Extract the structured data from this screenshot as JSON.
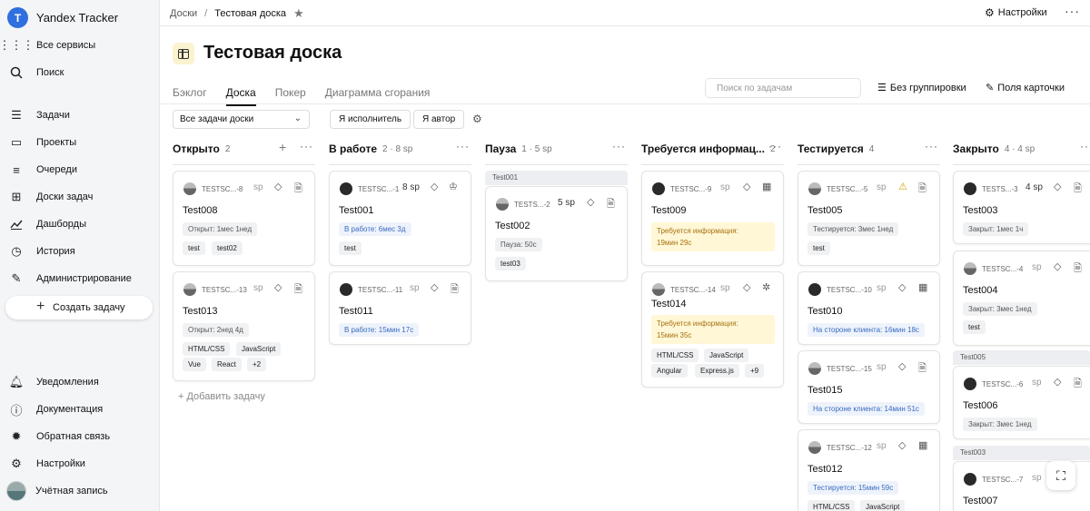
{
  "app": {
    "name": "Yandex Tracker",
    "logo_glyph": "T"
  },
  "sidebar": {
    "items": [
      {
        "label": "Все сервисы",
        "icon": "grid-icon"
      },
      {
        "label": "Поиск",
        "icon": "search-icon"
      },
      {
        "label": "Задачи",
        "icon": "tasks-icon"
      },
      {
        "label": "Проекты",
        "icon": "projects-icon"
      },
      {
        "label": "Очереди",
        "icon": "queues-icon"
      },
      {
        "label": "Доски задач",
        "icon": "boards-icon"
      },
      {
        "label": "Дашборды",
        "icon": "dashboards-icon"
      },
      {
        "label": "История",
        "icon": "history-icon"
      },
      {
        "label": "Администрирование",
        "icon": "admin-icon"
      }
    ],
    "create_label": "Создать задачу",
    "bottom_items": [
      {
        "label": "Уведомления",
        "icon": "bell-icon"
      },
      {
        "label": "Документация",
        "icon": "help-icon"
      },
      {
        "label": "Обратная связь",
        "icon": "feedback-icon"
      },
      {
        "label": "Настройки",
        "icon": "gear-icon"
      },
      {
        "label": "Учётная запись",
        "icon": "avatar"
      }
    ]
  },
  "header": {
    "breadcrumb": [
      "Доски",
      "Тестовая доска"
    ],
    "settings_label": "Настройки",
    "title": "Тестовая доска",
    "tabs": [
      "Бэклог",
      "Доска",
      "Покер",
      "Диаграмма сгорания"
    ],
    "active_tab": "Доска",
    "search_placeholder": "Поиск по задачам",
    "grouping_label": "Без группировки",
    "fields_label": "Поля карточки"
  },
  "filters": {
    "select_value": "Все задачи доски",
    "chips": [
      "Я исполнитель",
      "Я автор"
    ]
  },
  "columns": [
    {
      "title": "Открыто",
      "count": "2"
    },
    {
      "title": "В работе",
      "count": "2 · 8 sp"
    },
    {
      "title": "Пауза",
      "count": "1 · 5 sp"
    },
    {
      "title": "Требуется информац...",
      "count": "2"
    },
    {
      "title": "Тестируется",
      "count": "4"
    },
    {
      "title": "Закрыто",
      "count": "4 · 4 sp"
    }
  ],
  "cards": {
    "test008": {
      "key": "TESTSC...-8",
      "sp": "sp",
      "title": "Test008",
      "status": "Открыт: 1мес 1нед",
      "tags": [
        "test",
        "test02"
      ]
    },
    "test013": {
      "key": "TESTSC...-13",
      "sp": "sp",
      "title": "Test013",
      "status": "Открыт: 2нед 4д",
      "tags": [
        "HTML/CSS",
        "JavaScript",
        "Vue",
        "React",
        "+2"
      ]
    },
    "test001": {
      "key": "TESTSC...-1",
      "sp": "8 sp",
      "title": "Test001",
      "status": "В работе: 6мес 3д",
      "tags": [
        "test"
      ]
    },
    "test011": {
      "key": "TESTSC...-11",
      "sp": "sp",
      "title": "Test011",
      "status": "В работе: 15мин 17с"
    },
    "test002": {
      "group": "Test001",
      "key": "TESTS...-2",
      "sp": "5 sp",
      "title": "Test002",
      "status": "Пауза: 50с",
      "tags": [
        "test03"
      ]
    },
    "test009": {
      "key": "TESTSC...-9",
      "sp": "sp",
      "title": "Test009",
      "status_l1": "Требуется информация:",
      "status_l2": "19мин 29с"
    },
    "test014": {
      "key": "TESTSC...-14",
      "sp": "sp",
      "title": "Test014",
      "status_l1": "Требуется информация:",
      "status_l2": "15мин 35с",
      "tags": [
        "HTML/CSS",
        "JavaScript",
        "Angular",
        "Express.js",
        "+9"
      ]
    },
    "test005": {
      "key": "TESTSC...-5",
      "sp": "sp",
      "title": "Test005",
      "status": "Тестируется: 3мес 1нед",
      "tags": [
        "test"
      ]
    },
    "test010": {
      "key": "TESTSC...-10",
      "sp": "sp",
      "title": "Test010",
      "status": "На стороне клиента: 16мин 18с"
    },
    "test015": {
      "key": "TESTSC...-15",
      "sp": "sp",
      "title": "Test015",
      "status": "На стороне клиента: 14мин 51с"
    },
    "test012": {
      "key": "TESTSC...-12",
      "sp": "sp",
      "title": "Test012",
      "status": "Тестируется: 15мин 59с",
      "tags": [
        "HTML/CSS",
        "JavaScript"
      ]
    },
    "test003": {
      "key": "TESTS...-3",
      "sp": "4 sp",
      "title": "Test003",
      "status": "Закрыт: 1мес 1ч"
    },
    "test004": {
      "key": "TESTSC...-4",
      "sp": "sp",
      "title": "Test004",
      "status": "Закрыт: 3мес 1нед",
      "tags": [
        "test"
      ]
    },
    "test006": {
      "group": "Test005",
      "key": "TESTSC...-6",
      "sp": "sp",
      "title": "Test006",
      "status": "Закрыт: 3мес 1нед"
    },
    "test007": {
      "group": "Test003",
      "key": "TESTSC...-7",
      "sp": "sp",
      "title": "Test007"
    }
  },
  "add_task_label": "Добавить задачу"
}
